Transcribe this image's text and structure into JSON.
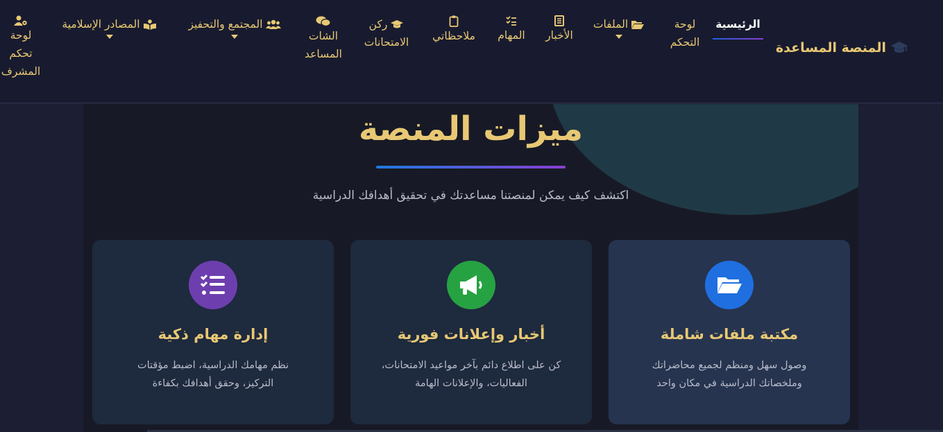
{
  "brand": {
    "name": "المنصة المساعدة",
    "icon": "graduation-cap-icon"
  },
  "nav": {
    "home": "الرئيسية",
    "dashboard": [
      "لوحة",
      "التحكم"
    ],
    "files": "الملفات",
    "news": "الأخبار",
    "tasks": "المهام",
    "notes": "ملاحظاتي",
    "exams": [
      "ركن",
      "الامتحانات"
    ],
    "chat": [
      "الشات",
      "المساعد"
    ],
    "community": "المجتمع والتحفيز",
    "islamic": "المصادر الإسلامية",
    "admin": [
      "لوحة",
      "تحكم",
      "المشرف"
    ]
  },
  "section": {
    "title": "ميزات المنصة",
    "subtitle": "اكتشف كيف يمكن لمنصتنا مساعدتك في تحقيق أهدافك الدراسية"
  },
  "cards": [
    {
      "icon": "folder-open-icon",
      "color": "#1f6fe0",
      "title": "مكتبة ملفات شاملة",
      "lines": [
        "وصول سهل ومنظم لجميع محاضراتك",
        "وملخصاتك الدراسية في مكان واحد"
      ]
    },
    {
      "icon": "megaphone-icon",
      "color": "#27a243",
      "title": "أخبار وإعلانات فورية",
      "lines": [
        "كن على اطلاع دائم بآخر مواعيد الامتحانات،",
        "الفعاليات، والإعلانات الهامة"
      ]
    },
    {
      "icon": "task-list-icon",
      "color": "#6d3fae",
      "title": "إدارة مهام ذكية",
      "lines": [
        "نظم مهامك الدراسية، اضبط مؤقتات",
        "التركيز، وحقق أهدافك بكفاءة"
      ]
    }
  ],
  "colors": {
    "accent": "#e8c874",
    "background": "#1c1f33",
    "navbar": "#181b2f"
  }
}
